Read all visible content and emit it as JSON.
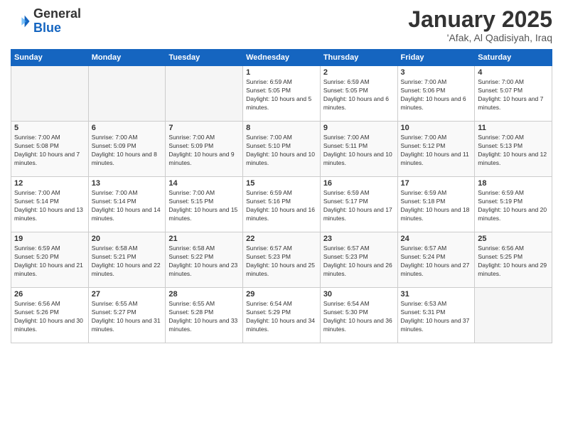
{
  "logo": {
    "general": "General",
    "blue": "Blue"
  },
  "header": {
    "title": "January 2025",
    "subtitle": "'Afak, Al Qadisiyah, Iraq"
  },
  "weekdays": [
    "Sunday",
    "Monday",
    "Tuesday",
    "Wednesday",
    "Thursday",
    "Friday",
    "Saturday"
  ],
  "weeks": [
    [
      {
        "day": "",
        "empty": true
      },
      {
        "day": "",
        "empty": true
      },
      {
        "day": "",
        "empty": true
      },
      {
        "day": "1",
        "sunrise": "6:59 AM",
        "sunset": "5:05 PM",
        "daylight": "10 hours and 5 minutes."
      },
      {
        "day": "2",
        "sunrise": "6:59 AM",
        "sunset": "5:05 PM",
        "daylight": "10 hours and 6 minutes."
      },
      {
        "day": "3",
        "sunrise": "7:00 AM",
        "sunset": "5:06 PM",
        "daylight": "10 hours and 6 minutes."
      },
      {
        "day": "4",
        "sunrise": "7:00 AM",
        "sunset": "5:07 PM",
        "daylight": "10 hours and 7 minutes."
      }
    ],
    [
      {
        "day": "5",
        "sunrise": "7:00 AM",
        "sunset": "5:08 PM",
        "daylight": "10 hours and 7 minutes."
      },
      {
        "day": "6",
        "sunrise": "7:00 AM",
        "sunset": "5:09 PM",
        "daylight": "10 hours and 8 minutes."
      },
      {
        "day": "7",
        "sunrise": "7:00 AM",
        "sunset": "5:09 PM",
        "daylight": "10 hours and 9 minutes."
      },
      {
        "day": "8",
        "sunrise": "7:00 AM",
        "sunset": "5:10 PM",
        "daylight": "10 hours and 10 minutes."
      },
      {
        "day": "9",
        "sunrise": "7:00 AM",
        "sunset": "5:11 PM",
        "daylight": "10 hours and 10 minutes."
      },
      {
        "day": "10",
        "sunrise": "7:00 AM",
        "sunset": "5:12 PM",
        "daylight": "10 hours and 11 minutes."
      },
      {
        "day": "11",
        "sunrise": "7:00 AM",
        "sunset": "5:13 PM",
        "daylight": "10 hours and 12 minutes."
      }
    ],
    [
      {
        "day": "12",
        "sunrise": "7:00 AM",
        "sunset": "5:14 PM",
        "daylight": "10 hours and 13 minutes."
      },
      {
        "day": "13",
        "sunrise": "7:00 AM",
        "sunset": "5:14 PM",
        "daylight": "10 hours and 14 minutes."
      },
      {
        "day": "14",
        "sunrise": "7:00 AM",
        "sunset": "5:15 PM",
        "daylight": "10 hours and 15 minutes."
      },
      {
        "day": "15",
        "sunrise": "6:59 AM",
        "sunset": "5:16 PM",
        "daylight": "10 hours and 16 minutes."
      },
      {
        "day": "16",
        "sunrise": "6:59 AM",
        "sunset": "5:17 PM",
        "daylight": "10 hours and 17 minutes."
      },
      {
        "day": "17",
        "sunrise": "6:59 AM",
        "sunset": "5:18 PM",
        "daylight": "10 hours and 18 minutes."
      },
      {
        "day": "18",
        "sunrise": "6:59 AM",
        "sunset": "5:19 PM",
        "daylight": "10 hours and 20 minutes."
      }
    ],
    [
      {
        "day": "19",
        "sunrise": "6:59 AM",
        "sunset": "5:20 PM",
        "daylight": "10 hours and 21 minutes."
      },
      {
        "day": "20",
        "sunrise": "6:58 AM",
        "sunset": "5:21 PM",
        "daylight": "10 hours and 22 minutes."
      },
      {
        "day": "21",
        "sunrise": "6:58 AM",
        "sunset": "5:22 PM",
        "daylight": "10 hours and 23 minutes."
      },
      {
        "day": "22",
        "sunrise": "6:57 AM",
        "sunset": "5:23 PM",
        "daylight": "10 hours and 25 minutes."
      },
      {
        "day": "23",
        "sunrise": "6:57 AM",
        "sunset": "5:23 PM",
        "daylight": "10 hours and 26 minutes."
      },
      {
        "day": "24",
        "sunrise": "6:57 AM",
        "sunset": "5:24 PM",
        "daylight": "10 hours and 27 minutes."
      },
      {
        "day": "25",
        "sunrise": "6:56 AM",
        "sunset": "5:25 PM",
        "daylight": "10 hours and 29 minutes."
      }
    ],
    [
      {
        "day": "26",
        "sunrise": "6:56 AM",
        "sunset": "5:26 PM",
        "daylight": "10 hours and 30 minutes."
      },
      {
        "day": "27",
        "sunrise": "6:55 AM",
        "sunset": "5:27 PM",
        "daylight": "10 hours and 31 minutes."
      },
      {
        "day": "28",
        "sunrise": "6:55 AM",
        "sunset": "5:28 PM",
        "daylight": "10 hours and 33 minutes."
      },
      {
        "day": "29",
        "sunrise": "6:54 AM",
        "sunset": "5:29 PM",
        "daylight": "10 hours and 34 minutes."
      },
      {
        "day": "30",
        "sunrise": "6:54 AM",
        "sunset": "5:30 PM",
        "daylight": "10 hours and 36 minutes."
      },
      {
        "day": "31",
        "sunrise": "6:53 AM",
        "sunset": "5:31 PM",
        "daylight": "10 hours and 37 minutes."
      },
      {
        "day": "",
        "empty": true
      }
    ]
  ]
}
